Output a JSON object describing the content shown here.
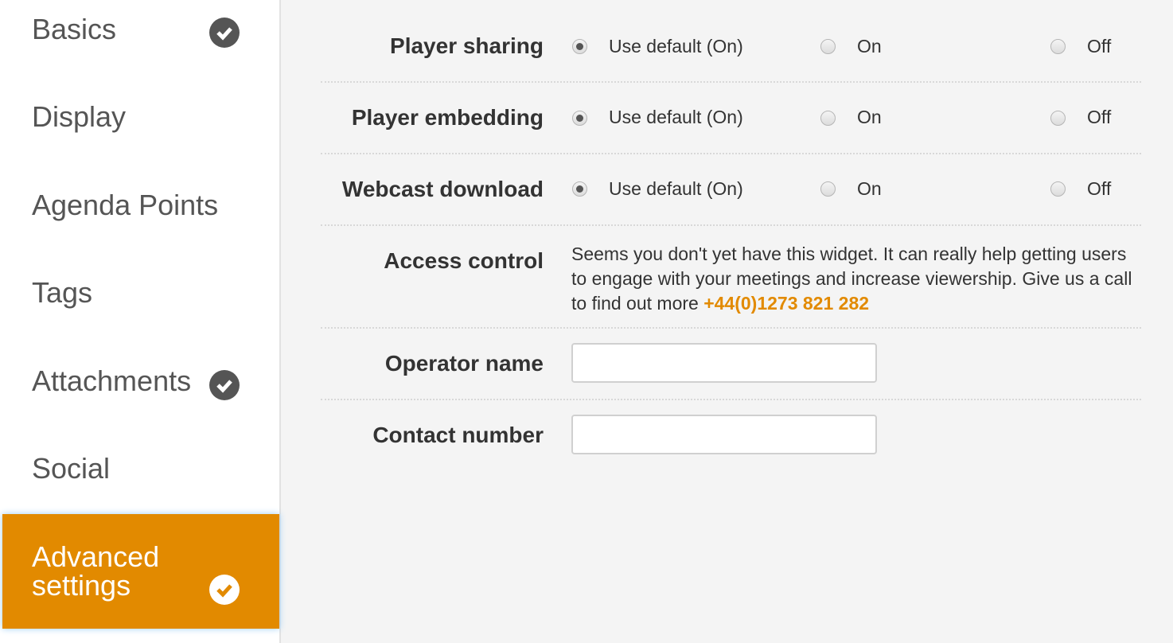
{
  "sidebar": {
    "items": [
      {
        "label": "Basics",
        "complete": true
      },
      {
        "label": "Display",
        "complete": false
      },
      {
        "label": "Agenda Points",
        "complete": false
      },
      {
        "label": "Tags",
        "complete": false
      },
      {
        "label": "Attachments",
        "complete": true
      },
      {
        "label": "Social",
        "complete": false
      },
      {
        "label": "Advanced settings",
        "complete": true,
        "active": true
      }
    ]
  },
  "colors": {
    "accent": "#e28a00"
  },
  "settings": [
    {
      "label": "Player sharing",
      "options": [
        "Use default (On)",
        "On",
        "Off"
      ],
      "selected": "Use default (On)"
    },
    {
      "label": "Player embedding",
      "options": [
        "Use default (On)",
        "On",
        "Off"
      ],
      "selected": "Use default (On)"
    },
    {
      "label": "Webcast download",
      "options": [
        "Use default (On)",
        "On",
        "Off"
      ],
      "selected": "Use default (On)"
    }
  ],
  "access": {
    "label": "Access control",
    "message": "Seems you don't yet have this widget. It can really help getting users to engage with your meetings and increase viewership. Give us a call to find out more",
    "phone": "+44(0)1273 821 282"
  },
  "operator": {
    "label": "Operator name",
    "value": ""
  },
  "contact": {
    "label": "Contact number",
    "value": ""
  }
}
